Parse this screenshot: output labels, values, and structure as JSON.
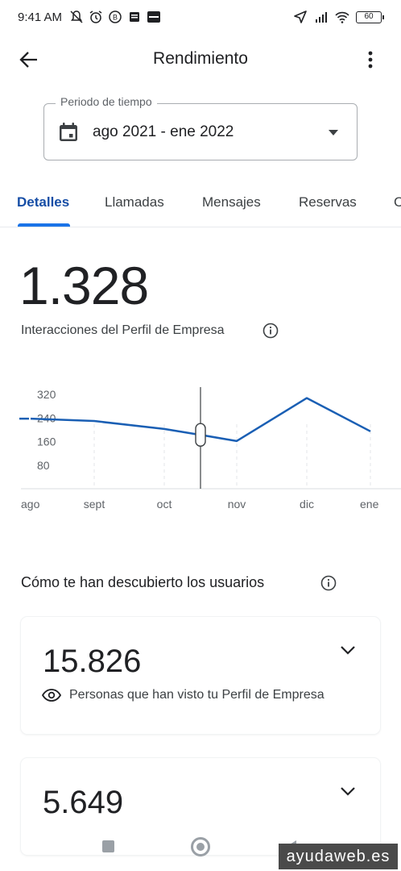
{
  "status_bar": {
    "time": "9:41 AM",
    "battery": "60",
    "left_icons": [
      "muted-bell-icon",
      "alarm-icon",
      "b-badge-icon",
      "news-icon",
      "ebay-icon"
    ],
    "right_icons": [
      "location-arrow-icon",
      "signal-icon",
      "wifi-icon",
      "battery-icon"
    ]
  },
  "app_bar": {
    "title": "Rendimiento"
  },
  "period": {
    "label": "Periodo de tiempo",
    "value": "ago 2021 - ene 2022"
  },
  "tabs": [
    {
      "label": "Detalles",
      "active": true
    },
    {
      "label": "Llamadas",
      "active": false
    },
    {
      "label": "Mensajes",
      "active": false
    },
    {
      "label": "Reservas",
      "active": false
    },
    {
      "label": "C",
      "active": false
    }
  ],
  "metric": {
    "value": "1.328",
    "label": "Interacciones del Perfil de Empresa"
  },
  "chart_data": {
    "type": "line",
    "y_ticks": [
      "320",
      "240",
      "160",
      "80"
    ],
    "x_labels": [
      "ago",
      "sept",
      "oct",
      "nov",
      "dic",
      "ene"
    ],
    "ylim": [
      0,
      400
    ],
    "series": [
      {
        "color": "#1a5fb4",
        "x": [
          0,
          0.4,
          1,
          2,
          2.5,
          3,
          4,
          5
        ],
        "values": [
          238,
          235,
          230,
          203,
          183,
          162,
          308,
          195
        ]
      }
    ],
    "cursor_x": 2.5,
    "grid": "vertical-dashed"
  },
  "discovery": {
    "heading": "Cómo te han descubierto los usuarios"
  },
  "cards": [
    {
      "value": "15.826",
      "label": "Personas que han visto tu Perfil de Empresa"
    },
    {
      "value": "5.649"
    }
  ],
  "watermark": "ayudaweb.es",
  "colors": {
    "accent": "#1a73e8",
    "line": "#1a5fb4",
    "text": "#202124"
  }
}
